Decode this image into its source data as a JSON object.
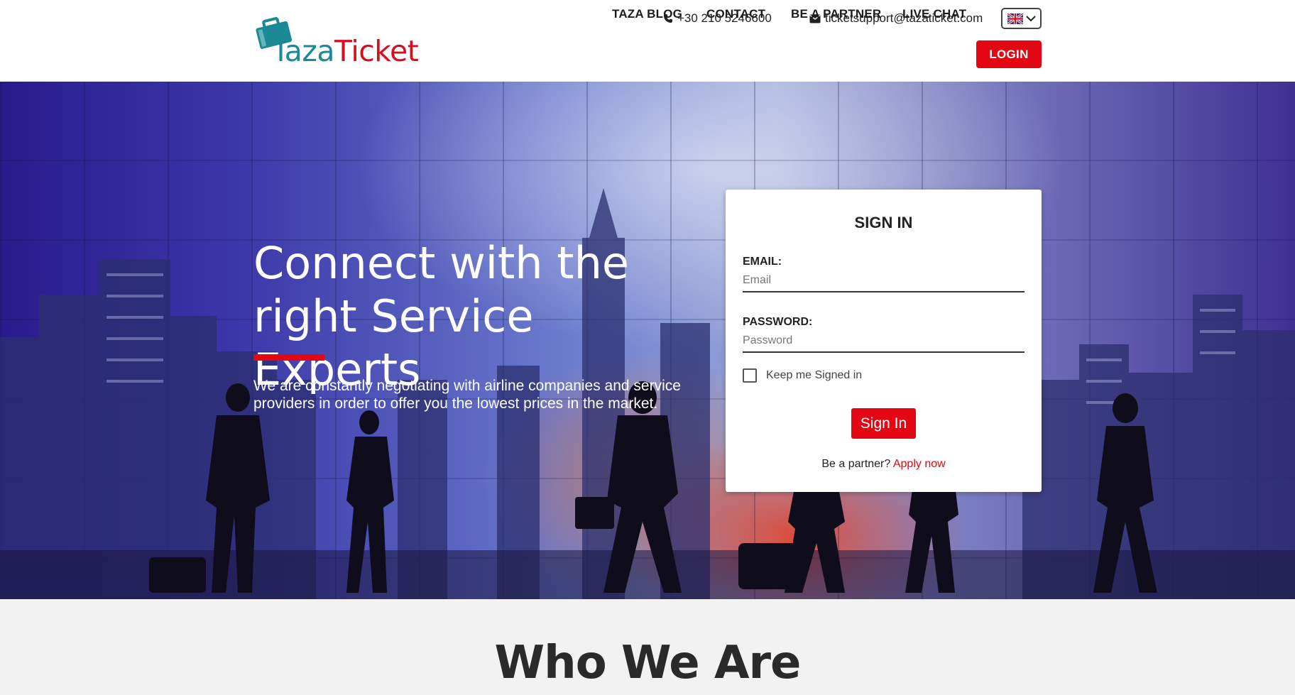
{
  "header": {
    "logo": {
      "part1": "Taza",
      "part2": "Ticket"
    },
    "phone": "+30 210 5246600",
    "email": "ticketsupport@tazaticket.com",
    "language": "EN",
    "nav": {
      "blog": "TAZA BLOG",
      "contact": "CONTACT",
      "partner": "BE A PARTNER",
      "chat": "LIVE CHAT",
      "login": "LOGIN"
    }
  },
  "hero": {
    "title_line1": "Connect with the",
    "title_line2": "right Service Experts",
    "description": "We are constantly negotiating with airline companies and service providers in order to offer you the lowest prices in the market."
  },
  "signin": {
    "title": "SIGN IN",
    "email_label": "EMAIL:",
    "email_placeholder": "Email",
    "password_label": "PASSWORD:",
    "password_placeholder": "Password",
    "keep_signed": "Keep me Signed in",
    "button": "Sign In",
    "partner_prompt": "Be a partner?",
    "apply_link": "Apply now"
  },
  "about": {
    "title": "Who We Are"
  },
  "colors": {
    "accent_red": "#e30613",
    "logo_teal": "#1b8a96"
  }
}
